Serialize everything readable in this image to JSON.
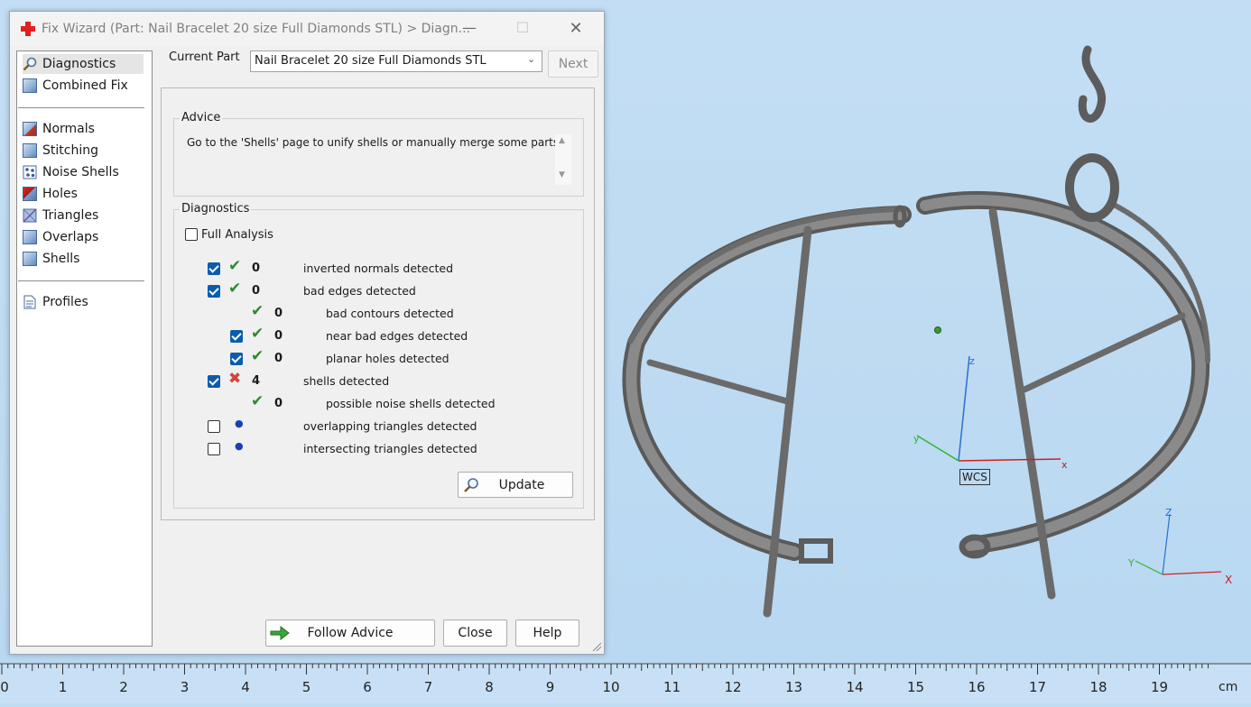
{
  "window": {
    "title": "Fix Wizard (Part: Nail Bracelet 20 size Full Diamonds STL) > Diagn..."
  },
  "nav": {
    "items": [
      {
        "label": "Diagnostics"
      },
      {
        "label": "Combined Fix"
      },
      {
        "label": "Normals"
      },
      {
        "label": "Stitching"
      },
      {
        "label": "Noise Shells"
      },
      {
        "label": "Holes"
      },
      {
        "label": "Triangles"
      },
      {
        "label": "Overlaps"
      },
      {
        "label": "Shells"
      },
      {
        "label": "Profiles"
      }
    ]
  },
  "current_part": {
    "label": "Current Part",
    "value": "Nail Bracelet 20 size Full Diamonds STL",
    "next_label": "Next"
  },
  "advice": {
    "title": "Advice",
    "text": "Go to the 'Shells' page to unify shells or manually merge some parts."
  },
  "diagnostics": {
    "title": "Diagnostics",
    "full_analysis": "Full Analysis",
    "rows": [
      {
        "count": "0",
        "text": "inverted normals detected",
        "checked": true,
        "status": "ok"
      },
      {
        "count": "0",
        "text": "bad edges detected",
        "checked": true,
        "status": "ok"
      },
      {
        "count": "0",
        "text": "bad contours detected",
        "checked": null,
        "status": "ok"
      },
      {
        "count": "0",
        "text": "near bad edges detected",
        "checked": true,
        "status": "ok"
      },
      {
        "count": "0",
        "text": "planar holes detected",
        "checked": true,
        "status": "ok"
      },
      {
        "count": "4",
        "text": "shells detected",
        "checked": true,
        "status": "error"
      },
      {
        "count": "0",
        "text": "possible noise shells detected",
        "checked": null,
        "status": "ok"
      },
      {
        "count": "",
        "text": "overlapping triangles detected",
        "checked": false,
        "status": "unknown"
      },
      {
        "count": "",
        "text": "intersecting triangles detected",
        "checked": false,
        "status": "unknown"
      }
    ],
    "update_label": "Update"
  },
  "footer": {
    "follow_advice": "Follow Advice",
    "close": "Close",
    "help": "Help"
  },
  "viewport": {
    "wcs_label": "WCS",
    "axes_main": {
      "x": "x",
      "y": "y",
      "z": "z"
    },
    "axes_corner": {
      "x": "X",
      "y": "Y",
      "z": "Z"
    }
  },
  "ruler": {
    "labels": [
      "0",
      "1",
      "2",
      "3",
      "4",
      "5",
      "6",
      "7",
      "8",
      "9",
      "10",
      "11",
      "12",
      "13",
      "14",
      "15",
      "16",
      "17",
      "18",
      "19"
    ],
    "unit": "cm"
  },
  "colors": {
    "accent": "#0b5cad",
    "ok": "#2e8b2e",
    "error": "#d0463a",
    "viewport": "#bfdcf3"
  }
}
